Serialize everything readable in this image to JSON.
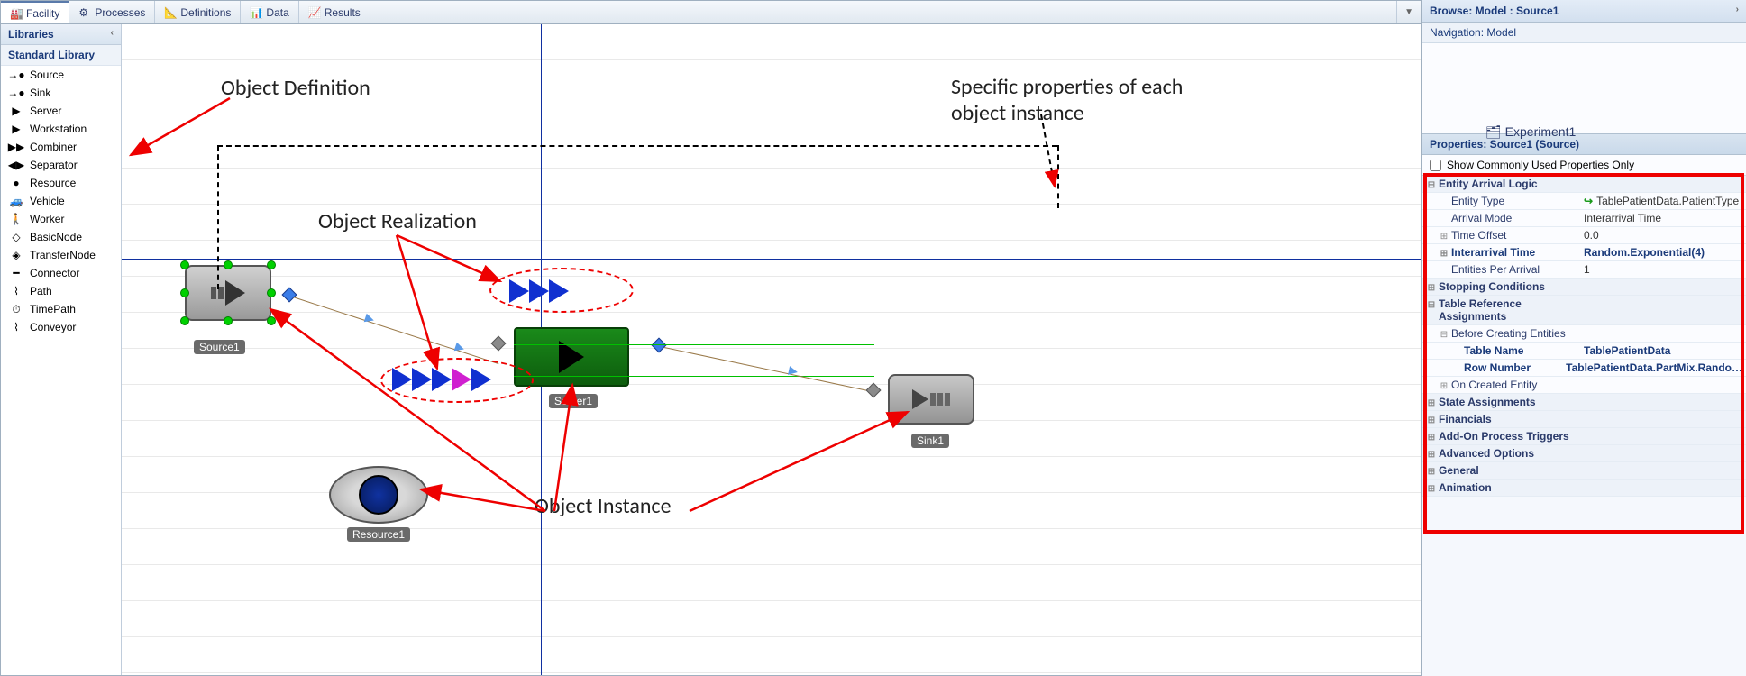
{
  "tabs": {
    "items": [
      {
        "label": "Facility",
        "active": true
      },
      {
        "label": "Processes"
      },
      {
        "label": "Definitions"
      },
      {
        "label": "Data"
      },
      {
        "label": "Results"
      }
    ]
  },
  "sidebar": {
    "header": "Libraries",
    "section": "Standard Library",
    "items": [
      {
        "label": "Source",
        "glyph": "→●"
      },
      {
        "label": "Sink",
        "glyph": "→●"
      },
      {
        "label": "Server",
        "glyph": "▶"
      },
      {
        "label": "Workstation",
        "glyph": "▶"
      },
      {
        "label": "Combiner",
        "glyph": "▶▶"
      },
      {
        "label": "Separator",
        "glyph": "◀▶"
      },
      {
        "label": "Resource",
        "glyph": "●"
      },
      {
        "label": "Vehicle",
        "glyph": "🚙"
      },
      {
        "label": "Worker",
        "glyph": "🚶"
      },
      {
        "label": "BasicNode",
        "glyph": "◇"
      },
      {
        "label": "TransferNode",
        "glyph": "◈"
      },
      {
        "label": "Connector",
        "glyph": "━"
      },
      {
        "label": "Path",
        "glyph": "⌇"
      },
      {
        "label": "TimePath",
        "glyph": "⏱"
      },
      {
        "label": "Conveyor",
        "glyph": "⌇"
      }
    ]
  },
  "canvas": {
    "nodes": {
      "source": "Source1",
      "server": "Server1",
      "sink": "Sink1",
      "resource": "Resource1"
    },
    "annotations": {
      "definition": "Object Definition",
      "realization": "Object Realization",
      "instance": "Object Instance",
      "properties": "Specific properties of each object instance",
      "experiment": "Experiment1"
    }
  },
  "right": {
    "browse": "Browse: Model : Source1",
    "navigation": "Navigation: Model",
    "props_header": "Properties: Source1 (Source)",
    "checkbox": "Show Commonly Used Properties Only",
    "rows": [
      {
        "k": "Entity Arrival Logic",
        "section": true,
        "toggle": "−"
      },
      {
        "k": "Entity Type",
        "v": "TablePatientData.PatientType",
        "ref": true,
        "indent": 1
      },
      {
        "k": "Arrival Mode",
        "v": "Interarrival Time",
        "indent": 1
      },
      {
        "k": "Time Offset",
        "v": "0.0",
        "indent": 1,
        "toggle": "+"
      },
      {
        "k": "Interarrival Time",
        "v": "Random.Exponential(4)",
        "bold": true,
        "indent": 1,
        "toggle": "+"
      },
      {
        "k": "Entities Per Arrival",
        "v": "1",
        "indent": 1
      },
      {
        "k": "Stopping Conditions",
        "section": true,
        "toggle": "+"
      },
      {
        "k": "Table Reference Assignments",
        "section": true,
        "toggle": "−"
      },
      {
        "k": "Before Creating Entities",
        "indent": 1,
        "toggle": "−"
      },
      {
        "k": "Table Name",
        "v": "TablePatientData",
        "bold": true,
        "indent": 2
      },
      {
        "k": "Row Number",
        "v": "TablePatientData.PartMix.Rando…",
        "bold": true,
        "indent": 2
      },
      {
        "k": "On Created Entity",
        "indent": 1,
        "toggle": "+"
      },
      {
        "k": "State Assignments",
        "section": true,
        "toggle": "+"
      },
      {
        "k": "Financials",
        "section": true,
        "toggle": "+"
      },
      {
        "k": "Add-On Process Triggers",
        "section": true,
        "toggle": "+"
      },
      {
        "k": "Advanced Options",
        "section": true,
        "toggle": "+"
      },
      {
        "k": "General",
        "section": true,
        "toggle": "+"
      },
      {
        "k": "Animation",
        "section": true,
        "toggle": "+"
      }
    ]
  }
}
